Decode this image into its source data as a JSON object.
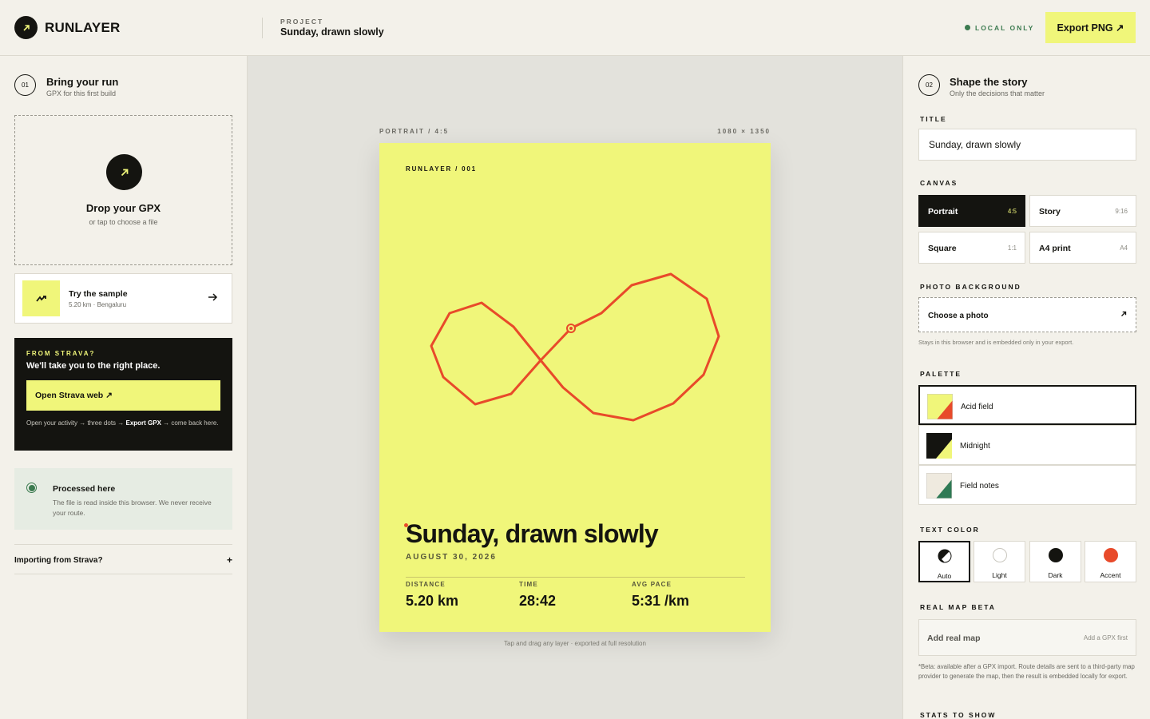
{
  "header": {
    "app_name": "RUNLAYER",
    "project_label": "PROJECT",
    "project_name": "Sunday, drawn slowly",
    "status": "LOCAL ONLY",
    "export_label": "Export PNG ↗"
  },
  "left": {
    "step_number": "01",
    "step_title": "Bring your run",
    "step_subtitle": "GPX for this first build",
    "drop_title": "Drop your GPX",
    "drop_subtitle": "or tap to choose a file",
    "sample_title": "Try the sample",
    "sample_subtitle": "5.20 km · Bengaluru",
    "strava_label": "FROM STRAVA?",
    "strava_title": "We'll take you to the right place.",
    "strava_button": "Open Strava web ↗",
    "strava_help_1": "Open your activity → three dots → ",
    "strava_help_bold": "Export GPX",
    "strava_help_2": " → come back here.",
    "processed_title": "Processed here",
    "processed_desc": "The file is read inside this browser. We never receive your route.",
    "import_label": "Importing from Strava?",
    "import_toggle": "+"
  },
  "preview": {
    "format_label": "PORTRAIT / 4:5",
    "size_label": "1080 × 1350",
    "brand": "RUNLAYER / 001",
    "title": "Sunday, drawn slowly",
    "date": "AUGUST 30, 2026",
    "stats": [
      {
        "label": "DISTANCE",
        "value": "5.20 km"
      },
      {
        "label": "TIME",
        "value": "28:42"
      },
      {
        "label": "AVG PACE",
        "value": "5:31 /km"
      }
    ],
    "hint": "Tap and drag any layer · exported at full resolution",
    "colors": {
      "background": "#f0f67a",
      "route": "#e84a2a"
    }
  },
  "right": {
    "step_number": "02",
    "step_title": "Shape the story",
    "step_subtitle": "Only the decisions that matter",
    "title_label": "TITLE",
    "title_value": "Sunday, drawn slowly",
    "canvas_label": "CANVAS",
    "canvas_options": [
      {
        "name": "Portrait",
        "ratio": "4:5",
        "selected": true
      },
      {
        "name": "Story",
        "ratio": "9:16",
        "selected": false
      },
      {
        "name": "Square",
        "ratio": "1:1",
        "selected": false
      },
      {
        "name": "A4 print",
        "ratio": "A4",
        "selected": false
      }
    ],
    "photo_label": "PHOTO BACKGROUND",
    "photo_button": "Choose a photo",
    "photo_note": "Stays in this browser and is embedded only in your export.",
    "palette_label": "PALETTE",
    "palettes": [
      {
        "name": "Acid field",
        "bg": "#f0f67a",
        "accent": "#e84a2a",
        "selected": true
      },
      {
        "name": "Midnight",
        "bg": "#141410",
        "accent": "#f0f67a",
        "selected": false
      },
      {
        "name": "Field notes",
        "bg": "#efeadf",
        "accent": "#2f7a55",
        "selected": false
      }
    ],
    "text_color_label": "TEXT COLOR",
    "text_colors": [
      {
        "name": "Auto",
        "selected": true
      },
      {
        "name": "Light",
        "selected": false
      },
      {
        "name": "Dark",
        "selected": false
      },
      {
        "name": "Accent",
        "selected": false
      }
    ],
    "map_label": "REAL MAP BETA",
    "map_button": "Add real map",
    "map_hint": "Add a GPX first",
    "map_note": "*Beta: available after a GPX import. Route details are sent to a third-party map provider to generate the map, then the result is embedded locally for export.",
    "stats_label": "STATS TO SHOW"
  }
}
